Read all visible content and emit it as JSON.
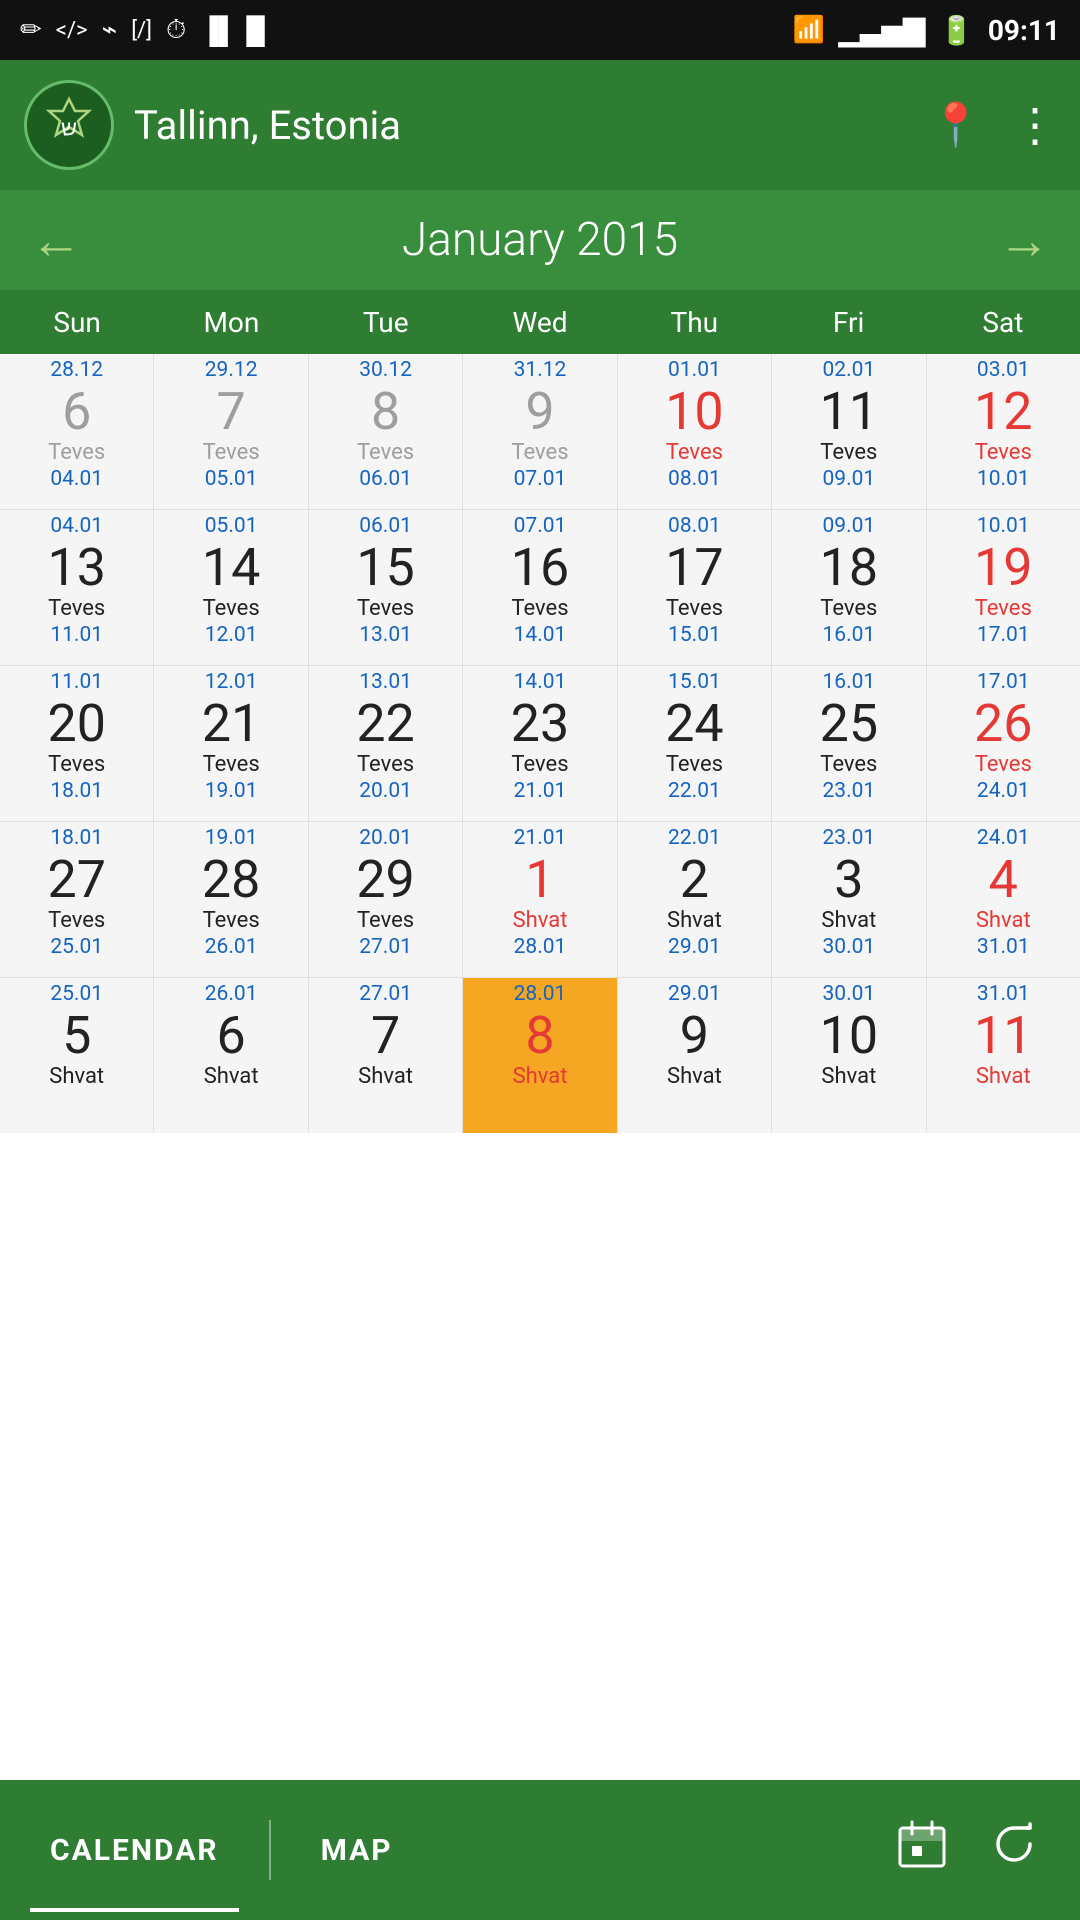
{
  "statusBar": {
    "time": "09:11",
    "icons_left": [
      "pencil-icon",
      "code-icon",
      "usb-icon",
      "brackets-icon",
      "clock-icon",
      "barcode-icon"
    ],
    "icons_right": [
      "wifi-icon",
      "signal-icon",
      "battery-icon"
    ]
  },
  "header": {
    "location": "Tallinn, Estonia",
    "logo_symbol": "ש"
  },
  "monthNav": {
    "title": "January 2015",
    "prev_arrow": "←",
    "next_arrow": "→"
  },
  "dayHeaders": [
    "Sun",
    "Mon",
    "Tue",
    "Wed",
    "Thu",
    "Fri",
    "Sat"
  ],
  "weeks": [
    {
      "cells": [
        {
          "topDate": "28.12",
          "mainDate": "6",
          "mainColor": "gray",
          "hebrew": "Teves",
          "hebrewColor": "gray",
          "bottomDate": "04.01"
        },
        {
          "topDate": "29.12",
          "mainDate": "7",
          "mainColor": "gray",
          "hebrew": "Teves",
          "hebrewColor": "gray",
          "bottomDate": "05.01"
        },
        {
          "topDate": "30.12",
          "mainDate": "8",
          "mainColor": "gray",
          "hebrew": "Teves",
          "hebrewColor": "gray",
          "bottomDate": "06.01"
        },
        {
          "topDate": "31.12",
          "mainDate": "9",
          "mainColor": "gray",
          "hebrew": "Teves",
          "hebrewColor": "gray",
          "bottomDate": "07.01"
        },
        {
          "topDate": "01.01",
          "mainDate": "10",
          "mainColor": "red",
          "hebrew": "Teves",
          "hebrewColor": "red",
          "bottomDate": "08.01"
        },
        {
          "topDate": "02.01",
          "mainDate": "11",
          "mainColor": "black",
          "hebrew": "Teves",
          "hebrewColor": "black",
          "bottomDate": "09.01"
        },
        {
          "topDate": "03.01",
          "mainDate": "12",
          "mainColor": "red",
          "hebrew": "Teves",
          "hebrewColor": "red",
          "bottomDate": "10.01"
        }
      ]
    },
    {
      "cells": [
        {
          "topDate": "04.01",
          "mainDate": "13",
          "mainColor": "black",
          "hebrew": "Teves",
          "hebrewColor": "black",
          "bottomDate": "11.01"
        },
        {
          "topDate": "05.01",
          "mainDate": "14",
          "mainColor": "black",
          "hebrew": "Teves",
          "hebrewColor": "black",
          "bottomDate": "12.01"
        },
        {
          "topDate": "06.01",
          "mainDate": "15",
          "mainColor": "black",
          "hebrew": "Teves",
          "hebrewColor": "black",
          "bottomDate": "13.01"
        },
        {
          "topDate": "07.01",
          "mainDate": "16",
          "mainColor": "black",
          "hebrew": "Teves",
          "hebrewColor": "black",
          "bottomDate": "14.01"
        },
        {
          "topDate": "08.01",
          "mainDate": "17",
          "mainColor": "black",
          "hebrew": "Teves",
          "hebrewColor": "black",
          "bottomDate": "15.01"
        },
        {
          "topDate": "09.01",
          "mainDate": "18",
          "mainColor": "black",
          "hebrew": "Teves",
          "hebrewColor": "black",
          "bottomDate": "16.01"
        },
        {
          "topDate": "10.01",
          "mainDate": "19",
          "mainColor": "red",
          "hebrew": "Teves",
          "hebrewColor": "red",
          "bottomDate": "17.01"
        }
      ]
    },
    {
      "cells": [
        {
          "topDate": "11.01",
          "mainDate": "20",
          "mainColor": "black",
          "hebrew": "Teves",
          "hebrewColor": "black",
          "bottomDate": "18.01"
        },
        {
          "topDate": "12.01",
          "mainDate": "21",
          "mainColor": "black",
          "hebrew": "Teves",
          "hebrewColor": "black",
          "bottomDate": "19.01"
        },
        {
          "topDate": "13.01",
          "mainDate": "22",
          "mainColor": "black",
          "hebrew": "Teves",
          "hebrewColor": "black",
          "bottomDate": "20.01"
        },
        {
          "topDate": "14.01",
          "mainDate": "23",
          "mainColor": "black",
          "hebrew": "Teves",
          "hebrewColor": "black",
          "bottomDate": "21.01"
        },
        {
          "topDate": "15.01",
          "mainDate": "24",
          "mainColor": "black",
          "hebrew": "Teves",
          "hebrewColor": "black",
          "bottomDate": "22.01"
        },
        {
          "topDate": "16.01",
          "mainDate": "25",
          "mainColor": "black",
          "hebrew": "Teves",
          "hebrewColor": "black",
          "bottomDate": "23.01"
        },
        {
          "topDate": "17.01",
          "mainDate": "26",
          "mainColor": "red",
          "hebrew": "Teves",
          "hebrewColor": "red",
          "bottomDate": "24.01"
        }
      ]
    },
    {
      "cells": [
        {
          "topDate": "18.01",
          "mainDate": "27",
          "mainColor": "black",
          "hebrew": "Teves",
          "hebrewColor": "black",
          "bottomDate": "25.01"
        },
        {
          "topDate": "19.01",
          "mainDate": "28",
          "mainColor": "black",
          "hebrew": "Teves",
          "hebrewColor": "black",
          "bottomDate": "26.01"
        },
        {
          "topDate": "20.01",
          "mainDate": "29",
          "mainColor": "black",
          "hebrew": "Teves",
          "hebrewColor": "black",
          "bottomDate": "27.01"
        },
        {
          "topDate": "21.01",
          "mainDate": "1",
          "mainColor": "red",
          "hebrew": "Shvat",
          "hebrewColor": "red",
          "bottomDate": "28.01"
        },
        {
          "topDate": "22.01",
          "mainDate": "2",
          "mainColor": "black",
          "hebrew": "Shvat",
          "hebrewColor": "black",
          "bottomDate": "29.01"
        },
        {
          "topDate": "23.01",
          "mainDate": "3",
          "mainColor": "black",
          "hebrew": "Shvat",
          "hebrewColor": "black",
          "bottomDate": "30.01"
        },
        {
          "topDate": "24.01",
          "mainDate": "4",
          "mainColor": "red",
          "hebrew": "Shvat",
          "hebrewColor": "red",
          "bottomDate": "31.01"
        }
      ]
    },
    {
      "cells": [
        {
          "topDate": "25.01",
          "mainDate": "5",
          "mainColor": "black",
          "hebrew": "Shvat",
          "hebrewColor": "black",
          "bottomDate": ""
        },
        {
          "topDate": "26.01",
          "mainDate": "6",
          "mainColor": "black",
          "hebrew": "Shvat",
          "hebrewColor": "black",
          "bottomDate": ""
        },
        {
          "topDate": "27.01",
          "mainDate": "7",
          "mainColor": "black",
          "hebrew": "Shvat",
          "hebrewColor": "black",
          "bottomDate": ""
        },
        {
          "topDate": "28.01",
          "mainDate": "8",
          "mainColor": "red",
          "hebrew": "Shvat",
          "hebrewColor": "red",
          "bottomDate": "",
          "today": true
        },
        {
          "topDate": "29.01",
          "mainDate": "9",
          "mainColor": "black",
          "hebrew": "Shvat",
          "hebrewColor": "black",
          "bottomDate": ""
        },
        {
          "topDate": "30.01",
          "mainDate": "10",
          "mainColor": "black",
          "hebrew": "Shvat",
          "hebrewColor": "black",
          "bottomDate": ""
        },
        {
          "topDate": "31.01",
          "mainDate": "11",
          "mainColor": "red",
          "hebrew": "Shvat",
          "hebrewColor": "red",
          "bottomDate": ""
        }
      ]
    }
  ],
  "bottomNav": {
    "tabs": [
      {
        "label": "CALENDAR",
        "active": true
      },
      {
        "label": "MAP",
        "active": false
      }
    ],
    "icons": [
      "calendar-today-icon",
      "refresh-icon"
    ]
  }
}
